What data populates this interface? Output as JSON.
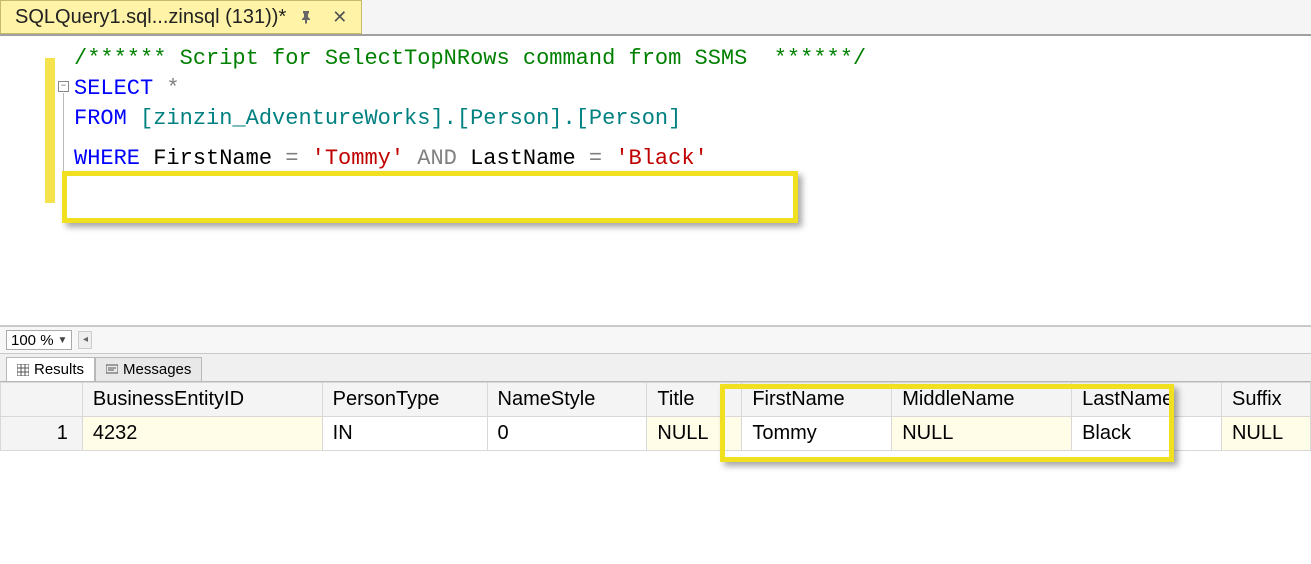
{
  "tab": {
    "title": "SQLQuery1.sql...zinsql (131))*"
  },
  "code": {
    "comment": "/****** Script for SelectTopNRows command from SSMS  ******/",
    "kw_select": "SELECT",
    "star": " *",
    "kw_from": "FROM",
    "from_rest": " [zinzin_AdventureWorks].[Person].[Person]",
    "kw_where": "WHERE",
    "where_col1": " FirstName ",
    "eq": "=",
    "where_val1": " 'Tommy' ",
    "kw_and": "AND",
    "where_col2": " LastName ",
    "where_val2": " 'Black'"
  },
  "status": {
    "zoom": "100 %"
  },
  "result_tabs": {
    "results": "Results",
    "messages": "Messages"
  },
  "grid": {
    "headers": [
      "",
      "BusinessEntityID",
      "PersonType",
      "NameStyle",
      "Title",
      "FirstName",
      "MiddleName",
      "LastName",
      "Suffix"
    ],
    "rownum": "1",
    "row": [
      "4232",
      "IN",
      "0",
      "NULL",
      "Tommy",
      "NULL",
      "Black",
      "NULL"
    ]
  }
}
